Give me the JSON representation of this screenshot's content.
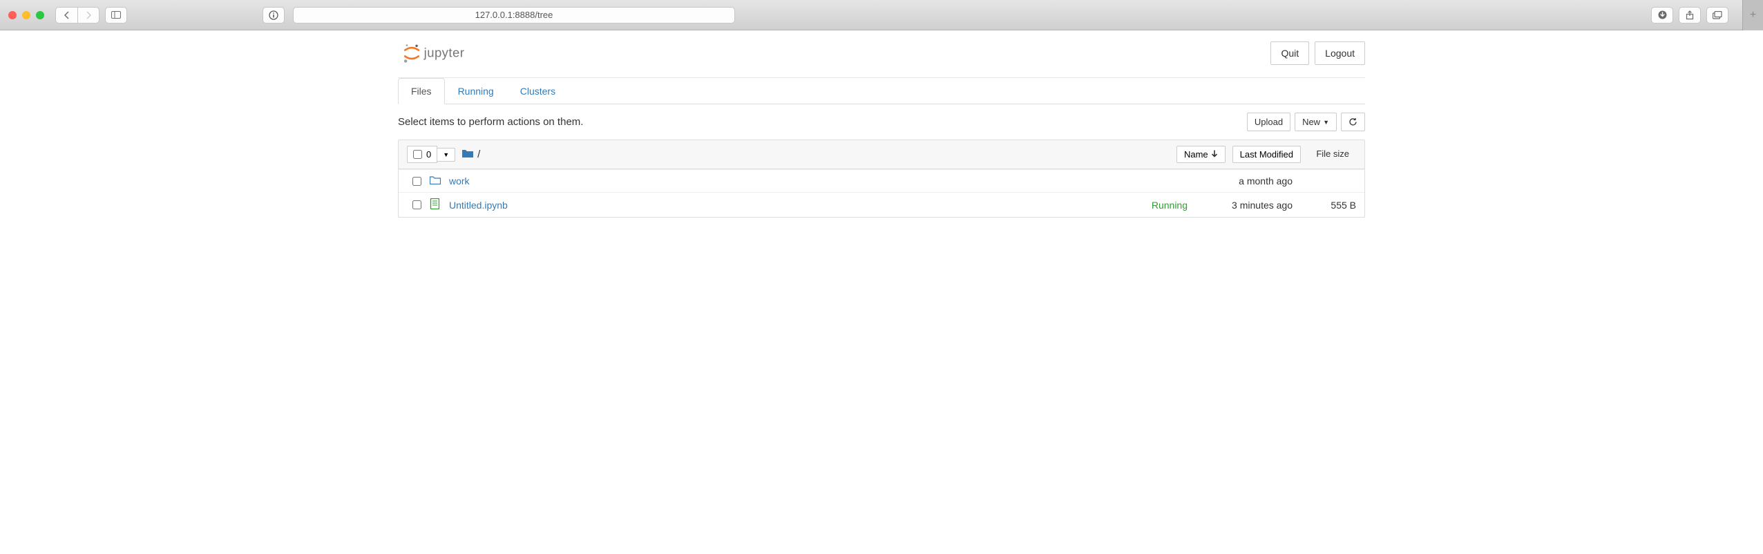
{
  "browser": {
    "url": "127.0.0.1:8888/tree"
  },
  "header": {
    "quit_label": "Quit",
    "logout_label": "Logout"
  },
  "tabs": {
    "files": "Files",
    "running": "Running",
    "clusters": "Clusters"
  },
  "actions": {
    "hint": "Select items to perform actions on them.",
    "upload_label": "Upload",
    "new_label": "New"
  },
  "listing": {
    "selected_count": "0",
    "breadcrumb_sep": "/",
    "name_col": "Name",
    "modified_col": "Last Modified",
    "size_col": "File size",
    "rows": [
      {
        "name": "work",
        "type": "folder",
        "status": "",
        "modified": "a month ago",
        "size": ""
      },
      {
        "name": "Untitled.ipynb",
        "type": "notebook",
        "status": "Running",
        "modified": "3 minutes ago",
        "size": "555 B"
      }
    ]
  }
}
